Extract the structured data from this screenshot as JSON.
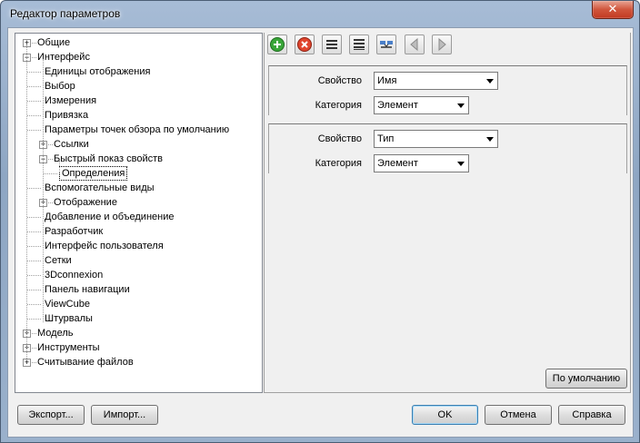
{
  "window": {
    "title": "Редактор параметров",
    "close_glyph": "✕"
  },
  "tree": {
    "items": [
      {
        "label": "Общие",
        "level": 0,
        "expander": "+"
      },
      {
        "label": "Интерфейс",
        "level": 0,
        "expander": "−"
      },
      {
        "label": "Единицы отображения",
        "level": 1,
        "expander": ""
      },
      {
        "label": "Выбор",
        "level": 1,
        "expander": ""
      },
      {
        "label": "Измерения",
        "level": 1,
        "expander": ""
      },
      {
        "label": "Привязка",
        "level": 1,
        "expander": ""
      },
      {
        "label": "Параметры точек обзора по умолчанию",
        "level": 1,
        "expander": ""
      },
      {
        "label": "Ссылки",
        "level": 1,
        "expander": "+"
      },
      {
        "label": "Быстрый показ свойств",
        "level": 1,
        "expander": "−"
      },
      {
        "label": "Определения",
        "level": 2,
        "expander": "",
        "selected": true
      },
      {
        "label": "Вспомогательные виды",
        "level": 1,
        "expander": ""
      },
      {
        "label": "Отображение",
        "level": 1,
        "expander": "+"
      },
      {
        "label": "Добавление и объединение",
        "level": 1,
        "expander": ""
      },
      {
        "label": "Разработчик",
        "level": 1,
        "expander": ""
      },
      {
        "label": "Интерфейс пользователя",
        "level": 1,
        "expander": ""
      },
      {
        "label": "Сетки",
        "level": 1,
        "expander": ""
      },
      {
        "label": "3Dconnexion",
        "level": 1,
        "expander": ""
      },
      {
        "label": "Панель навигации",
        "level": 1,
        "expander": ""
      },
      {
        "label": "ViewCube",
        "level": 1,
        "expander": ""
      },
      {
        "label": "Штурвалы",
        "level": 1,
        "expander": ""
      },
      {
        "label": "Модель",
        "level": 0,
        "expander": "+"
      },
      {
        "label": "Инструменты",
        "level": 0,
        "expander": "+"
      },
      {
        "label": "Считывание файлов",
        "level": 0,
        "expander": "+"
      }
    ]
  },
  "toolbar": {
    "buttons": [
      {
        "name": "add-icon"
      },
      {
        "name": "delete-icon"
      },
      {
        "name": "list-icon"
      },
      {
        "name": "list-alt-icon"
      },
      {
        "name": "swap-icon"
      },
      {
        "name": "prev-icon"
      },
      {
        "name": "next-icon"
      }
    ]
  },
  "definitions": [
    {
      "property_label": "Свойство",
      "property_value": "Имя",
      "category_label": "Категория",
      "category_value": "Элемент"
    },
    {
      "property_label": "Свойство",
      "property_value": "Тип",
      "category_label": "Категория",
      "category_value": "Элемент"
    }
  ],
  "buttons": {
    "defaults": "По умолчанию",
    "export": "Экспорт...",
    "import": "Импорт...",
    "ok": "OK",
    "cancel": "Отмена",
    "help": "Справка"
  }
}
